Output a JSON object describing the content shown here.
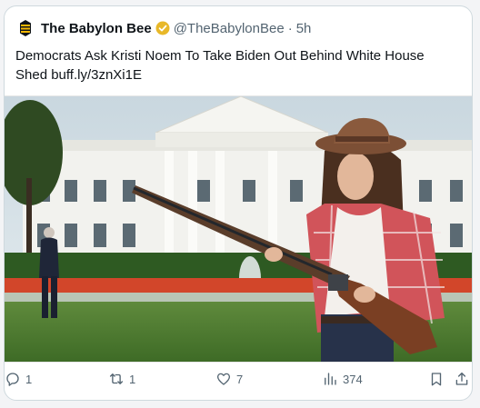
{
  "tweet": {
    "author_name": "The Babylon Bee",
    "handle": "@TheBabylonBee",
    "separator": "·",
    "time": "5h",
    "text_line1": "Democrats Ask Kristi Noem To Take Biden Out Behind White House",
    "text_line2": "Shed buff.ly/3znXi1E"
  },
  "actions": {
    "replies": "1",
    "retweets": "1",
    "likes": "7",
    "views": "374"
  },
  "colors": {
    "verified_badge": "#e8b829",
    "icon_gray": "#536471",
    "card_border": "#cfd9de"
  },
  "icons": [
    "bee-logo-icon",
    "verified-badge-icon",
    "reply-icon",
    "retweet-icon",
    "like-icon",
    "views-icon",
    "bookmark-icon",
    "share-icon"
  ]
}
